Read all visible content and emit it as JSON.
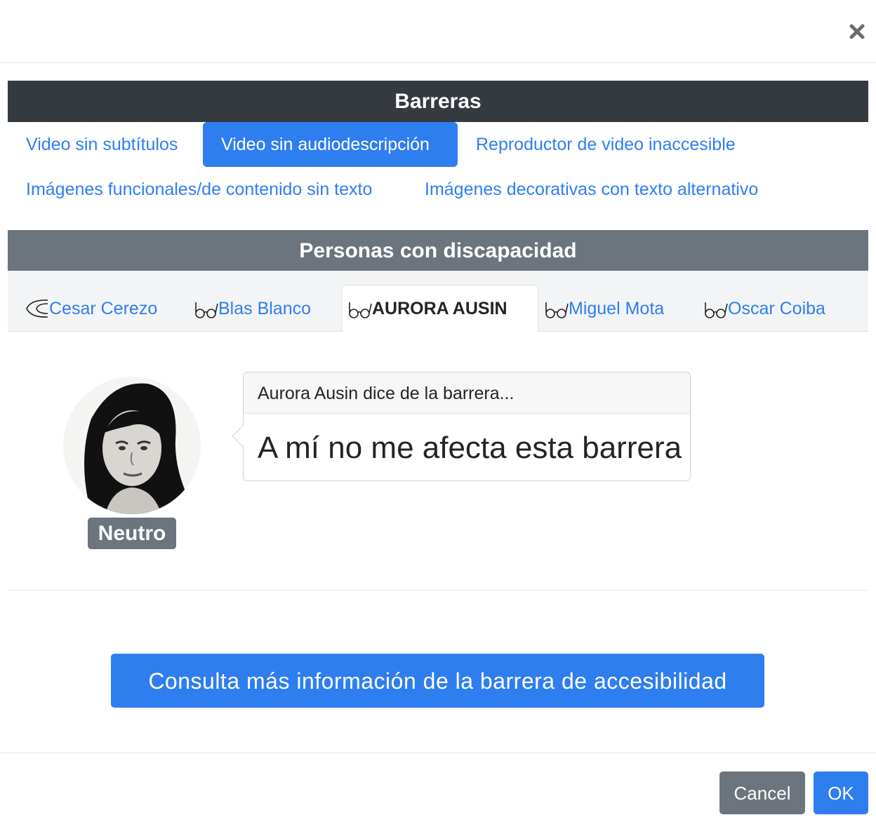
{
  "dialog": {
    "close_icon": "close-icon"
  },
  "barriers": {
    "title": "Barreras",
    "items": [
      {
        "label": "Video sin subtítulos",
        "active": false
      },
      {
        "label": "Video sin audiodescripción",
        "active": true
      },
      {
        "label": "Reproductor de video inaccesible",
        "active": false
      },
      {
        "label": "Imágenes funcionales/de contenido sin texto",
        "active": false
      },
      {
        "label": "Imágenes decorativas con texto alternativo",
        "active": false
      }
    ]
  },
  "personas": {
    "title": "Personas con discapacidad",
    "tabs": [
      {
        "label": "Cesar Cerezo",
        "icon": "ear-icon",
        "active": false
      },
      {
        "label": "Blas Blanco",
        "icon": "glasses-icon",
        "active": false
      },
      {
        "label": "AURORA AUSIN",
        "icon": "glasses-icon",
        "active": true
      },
      {
        "label": "Miguel Mota",
        "icon": "glasses-icon",
        "active": false
      },
      {
        "label": "Oscar Coiba",
        "icon": "glasses-icon",
        "active": false
      }
    ]
  },
  "opinion": {
    "status_badge": "Neutro",
    "header": "Aurora Ausin dice de la barrera...",
    "text": "A mí no me afecta esta barrera"
  },
  "more_info_button": "Consulta más información de la barrera de accesibilidad",
  "footer": {
    "cancel_label": "Cancel",
    "ok_label": "OK"
  },
  "colors": {
    "primary": "#2f7ef0",
    "dark_header": "#343a40",
    "secondary": "#6c757d"
  }
}
